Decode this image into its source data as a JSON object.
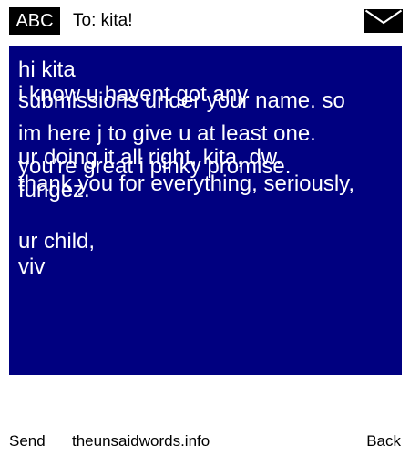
{
  "header": {
    "badge": "ABC",
    "recipient": "To: kita!",
    "envelope_icon": "envelope-icon"
  },
  "message": {
    "background_color": "#000080",
    "text_color": "#ffffff",
    "lines": [
      "hi kita",
      "i know u havent got any",
      "submissions under your name. so",
      "im here j to give u at least one.",
      "ur doing it all right, kita, dw.",
      "you're great i pinky promise.",
      "thank you for everything, seriously,",
      "fungez.",
      "ur child,",
      "viv"
    ]
  },
  "footer": {
    "send": "Send",
    "site": "theunsaidwords.info",
    "back": "Back"
  }
}
